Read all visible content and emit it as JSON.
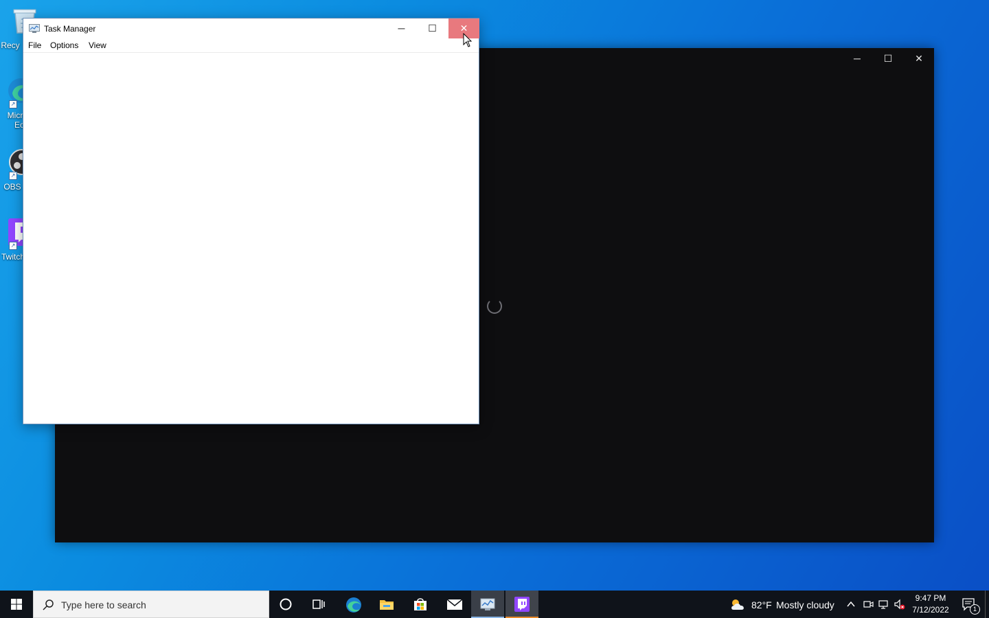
{
  "desktop_icons": [
    {
      "label": "Recy",
      "icon": "recycle-bin-icon"
    },
    {
      "label": "Micr Ec",
      "label_line1": "Micr",
      "label_line2": "Ec",
      "icon": "edge-icon"
    },
    {
      "label": "OBS",
      "icon": "obs-icon"
    },
    {
      "label": "Twitch",
      "icon": "twitch-icon"
    }
  ],
  "task_manager": {
    "title": "Task Manager",
    "menu": [
      "File",
      "Options",
      "View"
    ],
    "buttons": {
      "minimize": "─",
      "maximize": "☐",
      "close": "✕"
    }
  },
  "dark_window": {
    "buttons": {
      "minimize": "─",
      "maximize": "☐",
      "close": "✕"
    }
  },
  "taskbar": {
    "search_placeholder": "Type here to search",
    "pinned": [
      "cortana-icon",
      "task-view-icon",
      "edge-icon",
      "file-explorer-icon",
      "store-icon",
      "mail-icon",
      "task-manager-icon",
      "twitch-icon"
    ],
    "weather": {
      "temp": "82°F",
      "desc": "Mostly cloudy"
    },
    "clock": {
      "time": "9:47 PM",
      "date": "7/12/2022"
    },
    "notification_count": "1"
  },
  "colors": {
    "close_hover": "#e8797e",
    "twitch_purple": "#9146ff",
    "taskbar": "#0f131a"
  }
}
